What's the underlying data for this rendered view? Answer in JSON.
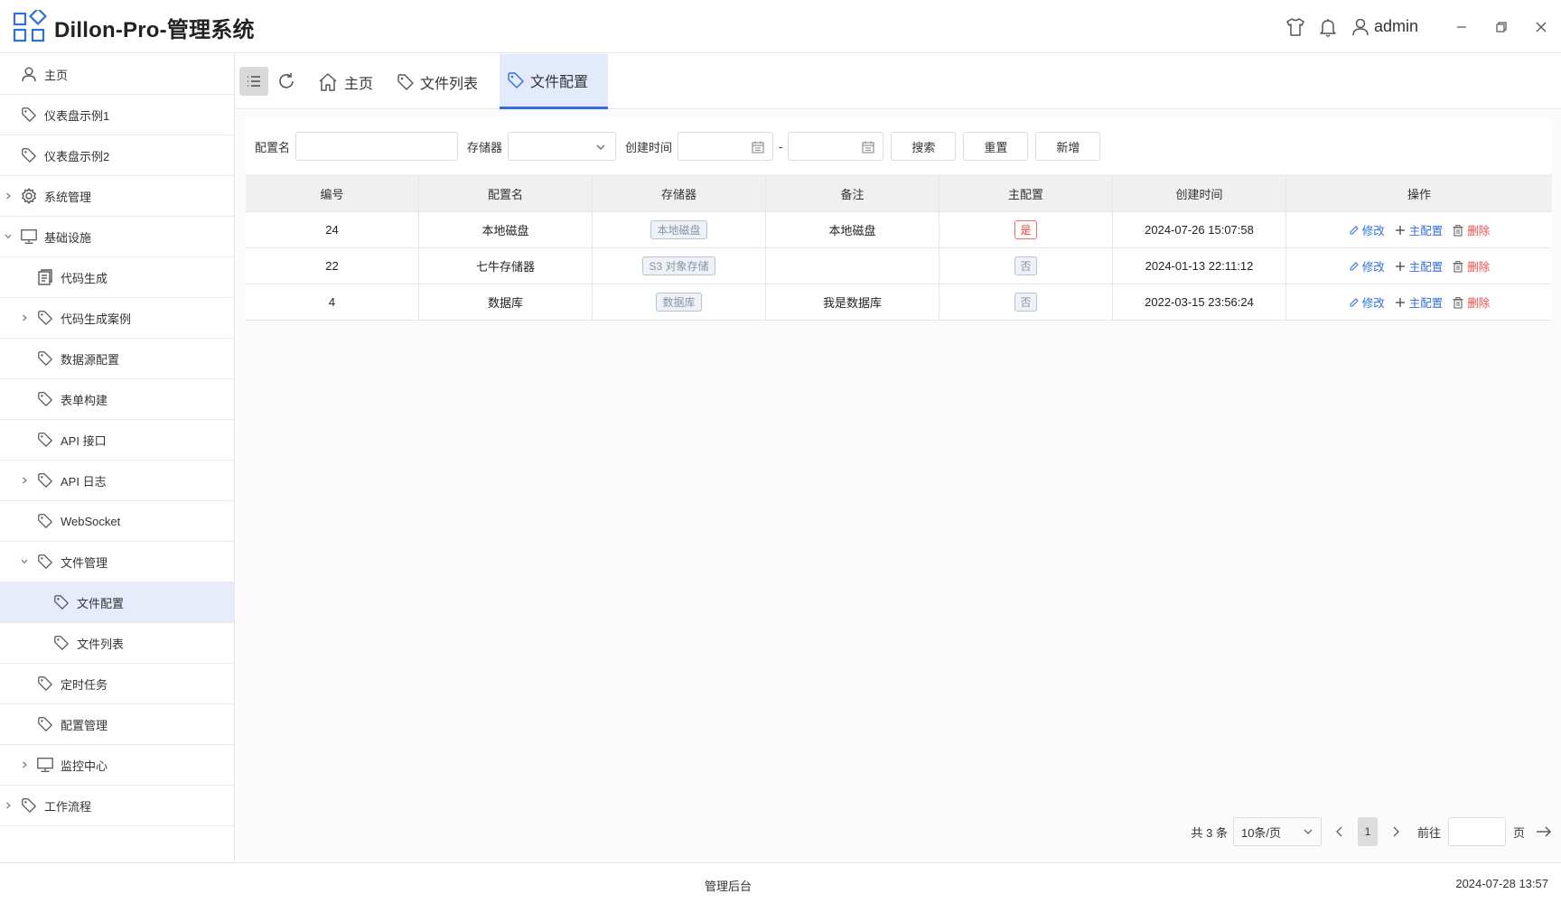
{
  "app": {
    "title": "Dillon-Pro-管理系统",
    "user": "admin"
  },
  "colors": {
    "accent": "#2f6fdf",
    "danger": "#f04c4c",
    "active_bg": "#e6ecfa"
  },
  "sidebar": {
    "items": [
      {
        "label": "主页",
        "icon": "user-icon",
        "arrow": ""
      },
      {
        "label": "仪表盘示例1",
        "icon": "tag-icon",
        "arrow": ""
      },
      {
        "label": "仪表盘示例2",
        "icon": "tag-icon",
        "arrow": ""
      },
      {
        "label": "系统管理",
        "icon": "gear-icon",
        "arrow": "right"
      },
      {
        "label": "基础设施",
        "icon": "monitor-icon",
        "arrow": "down"
      },
      {
        "label": "代码生成",
        "icon": "document-icon",
        "arrow": ""
      },
      {
        "label": "代码生成案例",
        "icon": "tag-icon",
        "arrow": "right"
      },
      {
        "label": "数据源配置",
        "icon": "tag-icon",
        "arrow": ""
      },
      {
        "label": "表单构建",
        "icon": "tag-icon",
        "arrow": ""
      },
      {
        "label": "API 接口",
        "icon": "tag-icon",
        "arrow": ""
      },
      {
        "label": "API 日志",
        "icon": "tag-icon",
        "arrow": "right"
      },
      {
        "label": "WebSocket",
        "icon": "tag-icon",
        "arrow": ""
      },
      {
        "label": "文件管理",
        "icon": "tag-icon",
        "arrow": "down"
      },
      {
        "label": "文件配置",
        "icon": "tag-icon",
        "arrow": "",
        "active": true
      },
      {
        "label": "文件列表",
        "icon": "tag-icon",
        "arrow": ""
      },
      {
        "label": "定时任务",
        "icon": "tag-icon",
        "arrow": ""
      },
      {
        "label": "配置管理",
        "icon": "tag-icon",
        "arrow": ""
      },
      {
        "label": "监控中心",
        "icon": "monitor-icon",
        "arrow": "right"
      },
      {
        "label": "工作流程",
        "icon": "tag-icon",
        "arrow": "right"
      }
    ]
  },
  "tabs": [
    {
      "label": "主页",
      "icon": "home-icon"
    },
    {
      "label": "文件列表",
      "icon": "tag-icon"
    },
    {
      "label": "文件配置",
      "icon": "tag-icon",
      "active": true
    }
  ],
  "search": {
    "config_name_label": "配置名",
    "config_name_value": "",
    "storage_label": "存储器",
    "storage_value": "",
    "created_label": "创建时间",
    "date_separator": "-",
    "search_button": "搜索",
    "reset_button": "重置",
    "add_button": "新增"
  },
  "table": {
    "headers": [
      "编号",
      "配置名",
      "存储器",
      "备注",
      "主配置",
      "创建时间",
      "操作"
    ],
    "rows": [
      {
        "id": "24",
        "name": "本地磁盘",
        "storage": "本地磁盘",
        "remark": "本地磁盘",
        "master": "是",
        "master_on": true,
        "created": "2024-07-26 15:07:58"
      },
      {
        "id": "22",
        "name": "七牛存储器",
        "storage": "S3 对象存储",
        "remark": "",
        "master": "否",
        "master_on": false,
        "created": "2024-01-13 22:11:12"
      },
      {
        "id": "4",
        "name": "数据库",
        "storage": "数据库",
        "remark": "我是数据库",
        "master": "否",
        "master_on": false,
        "created": "2022-03-15 23:56:24"
      }
    ],
    "actions": {
      "edit": "修改",
      "set_master": "主配置",
      "delete": "删除"
    }
  },
  "pagination": {
    "total": "共 3 条",
    "page_size": "10条/页",
    "current": "1",
    "goto_label": "前往",
    "page_suffix": "页"
  },
  "footer": {
    "center": "管理后台",
    "datetime": "2024-07-28 13:57"
  }
}
